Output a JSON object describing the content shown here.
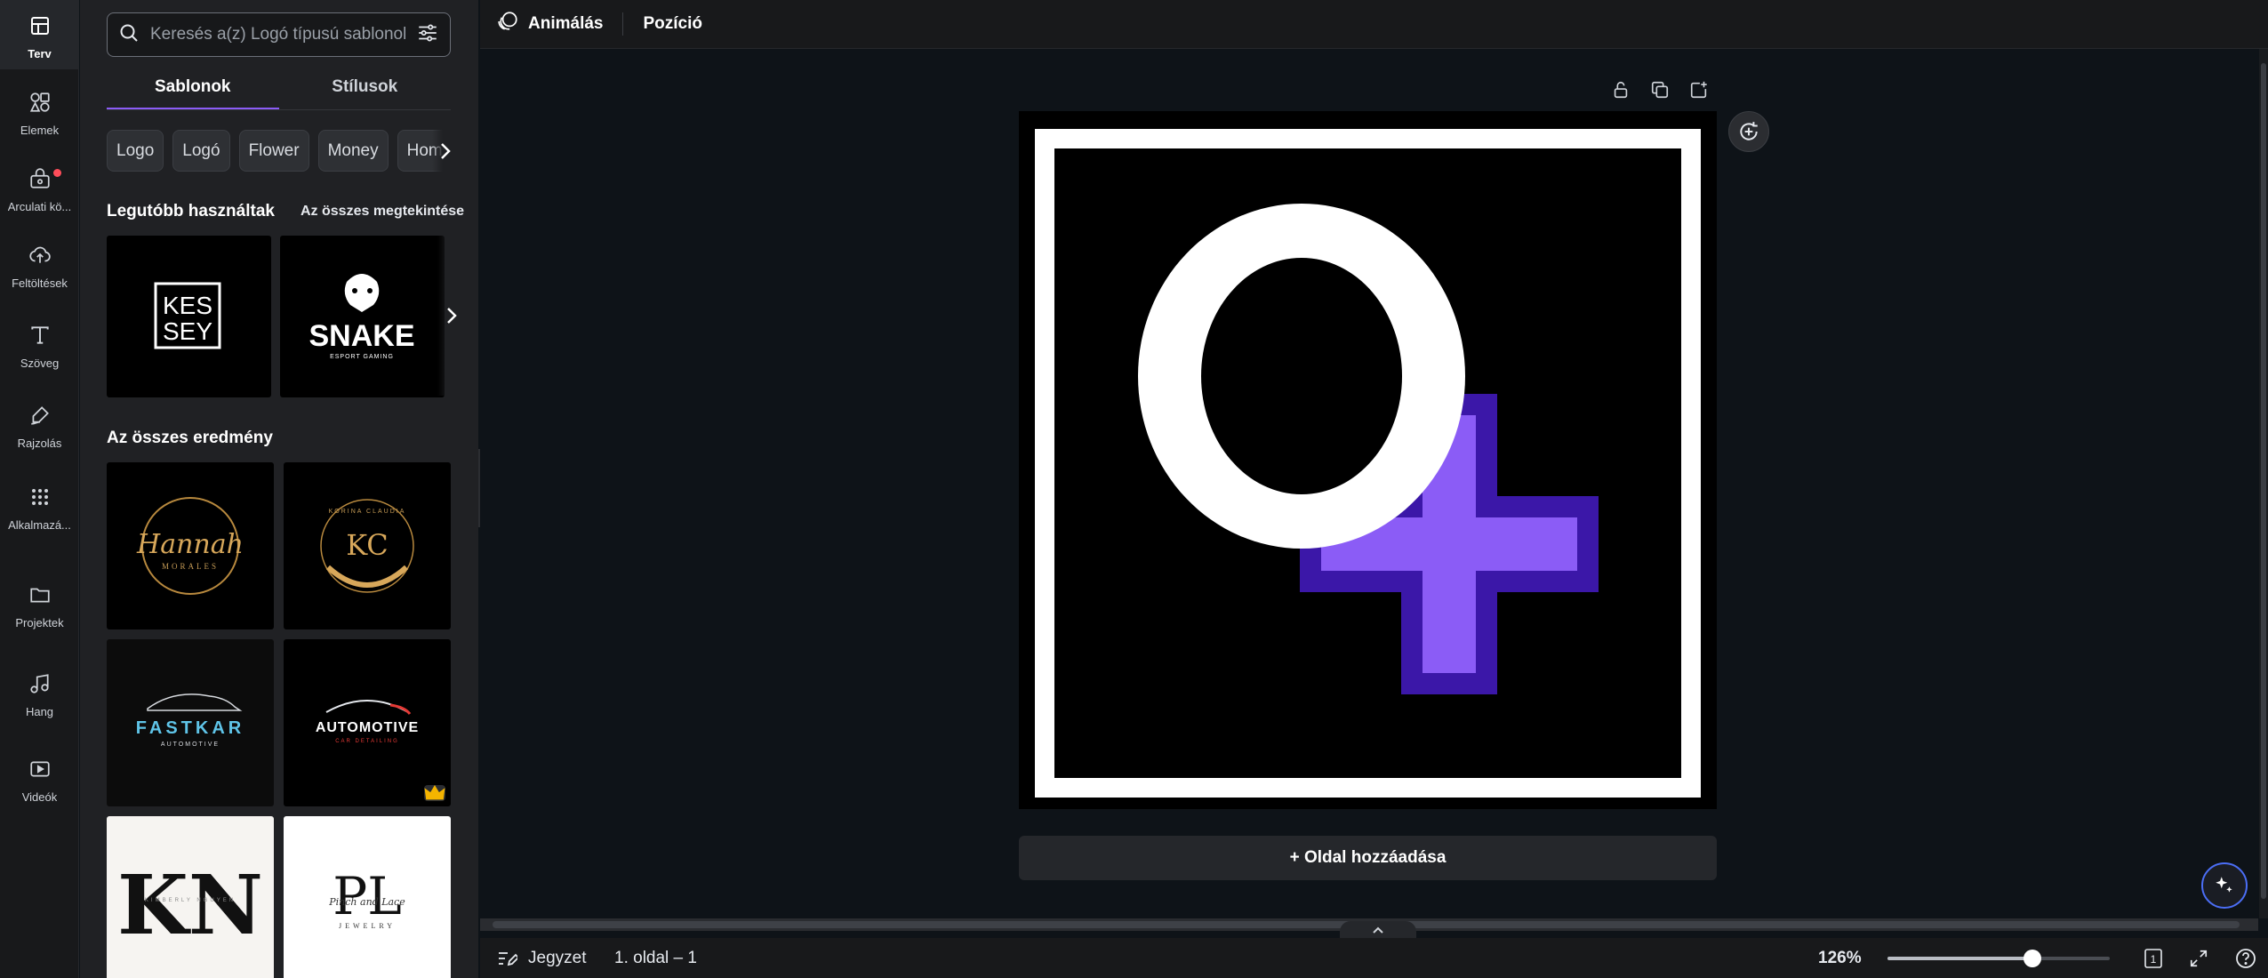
{
  "rail": {
    "items": [
      {
        "label": "Terv",
        "icon": "layout-icon"
      },
      {
        "label": "Elemek",
        "icon": "shapes-icon"
      },
      {
        "label": "Arculati kö...",
        "icon": "brand-kit-icon"
      },
      {
        "label": "Feltöltések",
        "icon": "upload-cloud-icon"
      },
      {
        "label": "Szöveg",
        "icon": "text-icon"
      },
      {
        "label": "Rajzolás",
        "icon": "draw-icon"
      },
      {
        "label": "Alkalmazá...",
        "icon": "apps-grid-icon"
      },
      {
        "label": "Projektek",
        "icon": "folder-icon"
      },
      {
        "label": "Hang",
        "icon": "music-icon"
      },
      {
        "label": "Videók",
        "icon": "video-icon"
      }
    ]
  },
  "panel": {
    "search_placeholder": "Keresés a(z) Logó típusú sablonok között",
    "tabs": [
      {
        "label": "Sablonok",
        "active": true
      },
      {
        "label": "Stílusok",
        "active": false
      }
    ],
    "chips": [
      "Logo",
      "Logó",
      "Flower",
      "Money",
      "Home"
    ],
    "recent_title": "Legutóbb használtak",
    "recent_link": "Az összes megtekintése",
    "recent": [
      {
        "lines": [
          "KES",
          "SEY"
        ]
      },
      {
        "title": "SNAKE",
        "sub": "ESPORT GAMING"
      }
    ],
    "results_title": "Az összes eredmény",
    "results": [
      {
        "script": "Hannah",
        "sub": "MORALES"
      },
      {
        "mono": "KC",
        "ring": "KORINA CLAUDIA"
      },
      {
        "title": "FASTKAR",
        "sub": "AUTOMOTIVE"
      },
      {
        "title": "AUTOMOTIVE",
        "sub": "CAR DETAILING",
        "premium": true
      },
      {
        "mono": "KN",
        "sub": "KIMBERLY NGUYEN"
      },
      {
        "mono": "PL",
        "script": "Pinch and Lace",
        "sub": "JEWELRY"
      }
    ]
  },
  "toolbar": {
    "animate": "Animálás",
    "position": "Pozíció"
  },
  "canvas": {
    "letter": "O",
    "accent": "#8b5cf6",
    "accent_dark": "#3b17a8",
    "add_page": "+ Oldal hozzáadása"
  },
  "bottom": {
    "notes": "Jegyzet",
    "page": "1. oldal – 1",
    "zoom": "126%",
    "zoom_level": 0.65,
    "page_count": "1"
  },
  "colors": {
    "brand_purple": "#8b5cf6",
    "panel_bg": "#202124",
    "rail_bg": "#18191b"
  }
}
